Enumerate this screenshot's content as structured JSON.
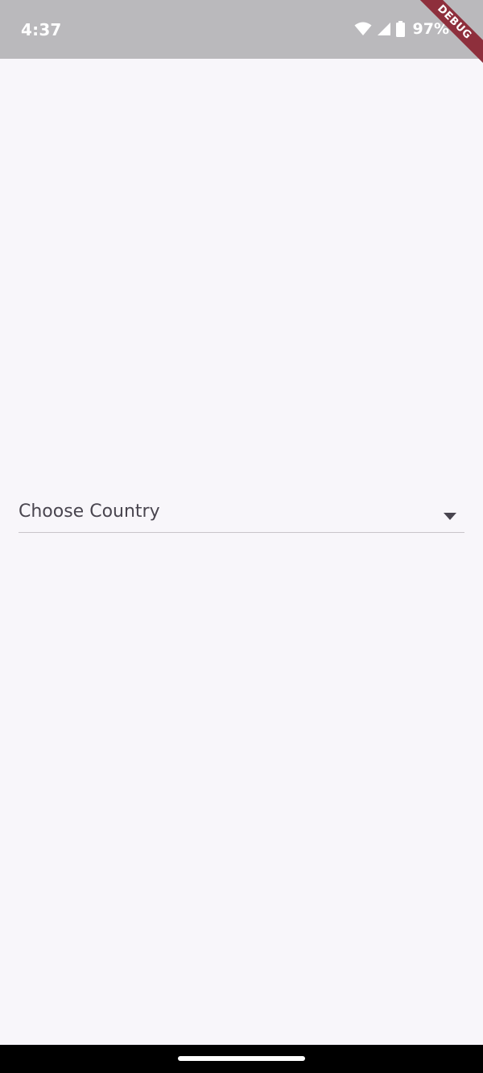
{
  "status_bar": {
    "time": "4:37",
    "battery_percent": "97%",
    "icons": [
      "wifi-icon",
      "signal-icon",
      "battery-icon"
    ]
  },
  "debug_banner": {
    "label": "DEBUG",
    "color": "#8e2f3c"
  },
  "main": {
    "dropdown": {
      "label": "Choose Country",
      "icon": "arrow-drop-down-icon"
    }
  },
  "colors": {
    "background": "#f8f6fa",
    "status_bar": "#bab9bc",
    "text": "#49454f",
    "underline": "#c9c5ca"
  }
}
